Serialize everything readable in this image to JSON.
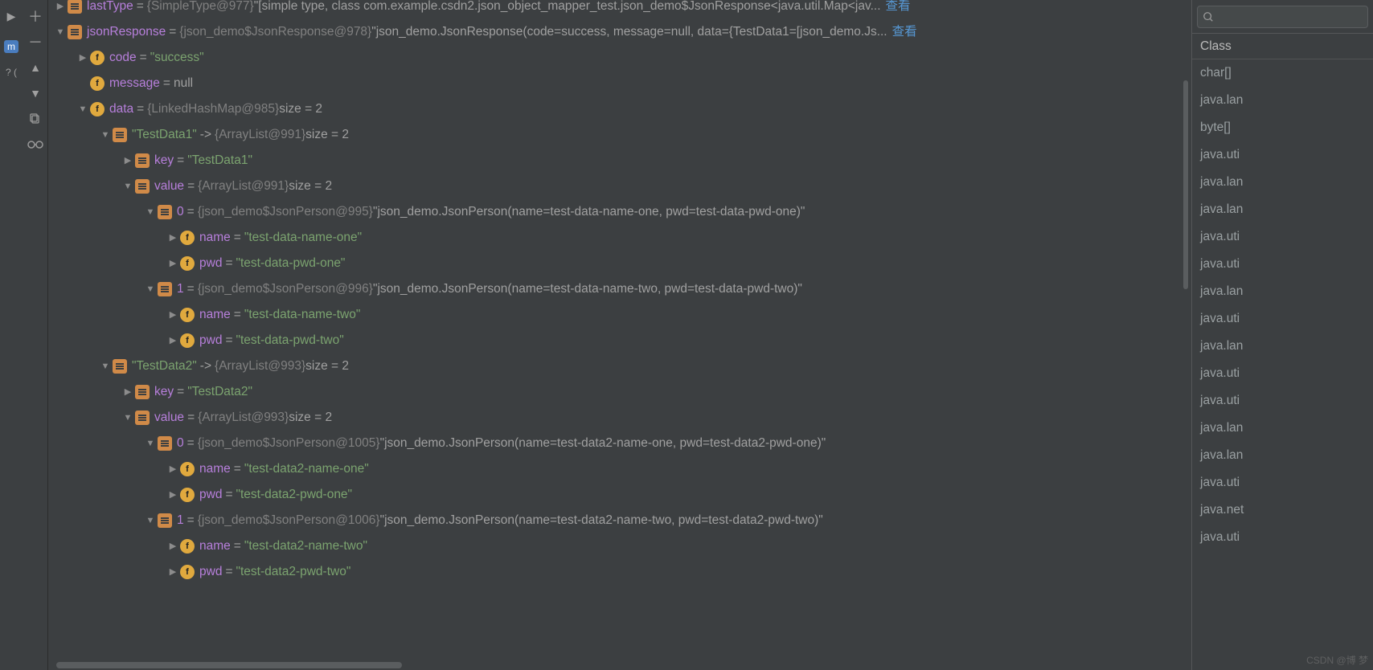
{
  "toolbar": {
    "badge_m": "m",
    "paren": "?  ("
  },
  "tree": [
    {
      "indent": 0,
      "tw": "closed",
      "icon": "obj",
      "purple": "lastType",
      "gray": "{SimpleType@977}",
      "tail": "\"[simple type, class com.example.csdn2.json_object_mapper_test.json_demo$JsonResponse<java.util.Map<jav...",
      "link": "查看"
    },
    {
      "indent": 0,
      "tw": "open",
      "icon": "obj",
      "purple": "jsonResponse",
      "gray": "{json_demo$JsonResponse@978}",
      "tail": "\"json_demo.JsonResponse(code=success, message=null, data={TestData1=[json_demo.Js...",
      "link": "查看"
    },
    {
      "indent": 1,
      "tw": "closed",
      "icon": "f",
      "purple": "code",
      "str": "\"success\""
    },
    {
      "indent": 1,
      "tw": "none",
      "icon": "f",
      "purple": "message",
      "nullv": "null"
    },
    {
      "indent": 1,
      "tw": "open",
      "icon": "f",
      "purple": "data",
      "gray": "{LinkedHashMap@985}",
      "size": "size = 2"
    },
    {
      "indent": 2,
      "tw": "open",
      "icon": "map",
      "str": "\"TestData1\"",
      "arrow": "->",
      "gray": "{ArrayList@991}",
      "size": "size = 2"
    },
    {
      "indent": 3,
      "tw": "closed",
      "icon": "map",
      "purple": "key",
      "str": "\"TestData1\""
    },
    {
      "indent": 3,
      "tw": "open",
      "icon": "map",
      "purple": "value",
      "gray": "{ArrayList@991}",
      "size": "size = 2"
    },
    {
      "indent": 4,
      "tw": "open",
      "icon": "map",
      "idx": "0",
      "gray": "{json_demo$JsonPerson@995}",
      "tail": "\"json_demo.JsonPerson(name=test-data-name-one, pwd=test-data-pwd-one)\""
    },
    {
      "indent": 5,
      "tw": "closed",
      "icon": "f",
      "purple": "name",
      "str": "\"test-data-name-one\""
    },
    {
      "indent": 5,
      "tw": "closed",
      "icon": "f",
      "purple": "pwd",
      "str": "\"test-data-pwd-one\""
    },
    {
      "indent": 4,
      "tw": "open",
      "icon": "map",
      "idx": "1",
      "gray": "{json_demo$JsonPerson@996}",
      "tail": "\"json_demo.JsonPerson(name=test-data-name-two, pwd=test-data-pwd-two)\""
    },
    {
      "indent": 5,
      "tw": "closed",
      "icon": "f",
      "purple": "name",
      "str": "\"test-data-name-two\""
    },
    {
      "indent": 5,
      "tw": "closed",
      "icon": "f",
      "purple": "pwd",
      "str": "\"test-data-pwd-two\""
    },
    {
      "indent": 2,
      "tw": "open",
      "icon": "map",
      "str": "\"TestData2\"",
      "arrow": "->",
      "gray": "{ArrayList@993}",
      "size": "size = 2"
    },
    {
      "indent": 3,
      "tw": "closed",
      "icon": "map",
      "purple": "key",
      "str": "\"TestData2\""
    },
    {
      "indent": 3,
      "tw": "open",
      "icon": "map",
      "purple": "value",
      "gray": "{ArrayList@993}",
      "size": "size = 2"
    },
    {
      "indent": 4,
      "tw": "open",
      "icon": "map",
      "idx": "0",
      "gray": "{json_demo$JsonPerson@1005}",
      "tail": "\"json_demo.JsonPerson(name=test-data2-name-one, pwd=test-data2-pwd-one)\""
    },
    {
      "indent": 5,
      "tw": "closed",
      "icon": "f",
      "purple": "name",
      "str": "\"test-data2-name-one\""
    },
    {
      "indent": 5,
      "tw": "closed",
      "icon": "f",
      "purple": "pwd",
      "str": "\"test-data2-pwd-one\""
    },
    {
      "indent": 4,
      "tw": "open",
      "icon": "map",
      "idx": "1",
      "gray": "{json_demo$JsonPerson@1006}",
      "tail": "\"json_demo.JsonPerson(name=test-data2-name-two, pwd=test-data2-pwd-two)\""
    },
    {
      "indent": 5,
      "tw": "closed",
      "icon": "f",
      "purple": "name",
      "str": "\"test-data2-name-two\""
    },
    {
      "indent": 5,
      "tw": "closed",
      "icon": "f",
      "purple": "pwd",
      "str": "\"test-data2-pwd-two\""
    }
  ],
  "right": {
    "header": "Class",
    "items": [
      "char[]",
      "java.lan",
      "byte[]",
      "java.uti",
      "java.lan",
      "java.lan",
      "java.uti",
      "java.uti",
      "java.lan",
      "java.uti",
      "java.lan",
      "java.uti",
      "java.uti",
      "java.lan",
      "java.lan",
      "java.uti",
      "java.net",
      "java.uti"
    ]
  },
  "watermark": "CSDN @博 梦"
}
